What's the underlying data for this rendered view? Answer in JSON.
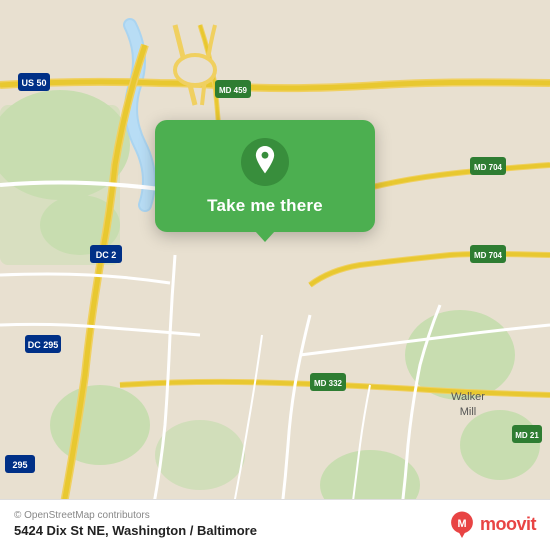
{
  "map": {
    "alt": "OpenStreetMap of Washington/Baltimore area"
  },
  "card": {
    "button_label": "Take me there",
    "pin_icon": "location-pin"
  },
  "bottom_bar": {
    "copyright": "© OpenStreetMap contributors",
    "address": "5424 Dix St NE, Washington / Baltimore",
    "logo_text": "moovit"
  }
}
